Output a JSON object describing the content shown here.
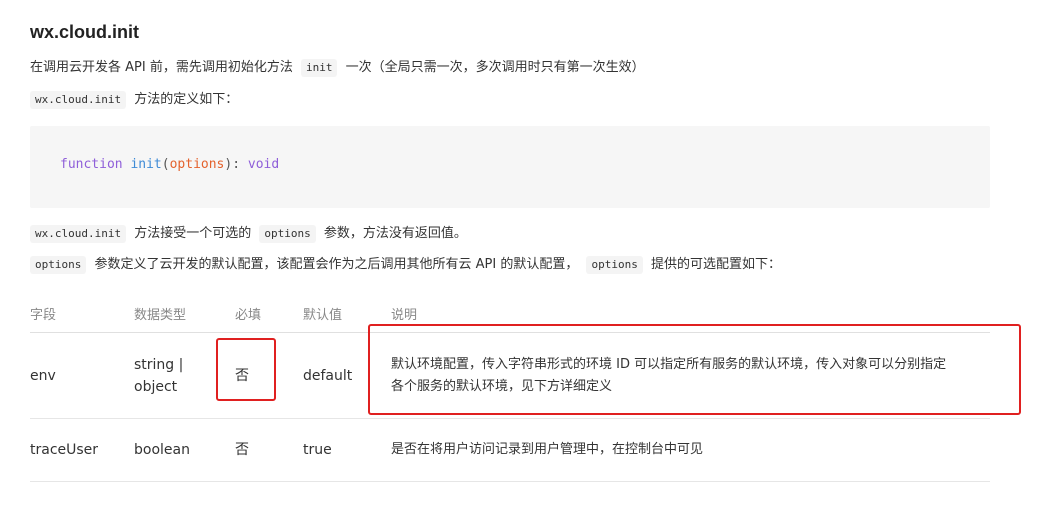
{
  "title": "wx.cloud.init",
  "intro": {
    "text_before": "在调用云开发各 API 前，需先调用初始化方法",
    "code": "init",
    "text_after": "一次（全局只需一次，多次调用时只有第一次生效）"
  },
  "definition_line": {
    "code": "wx.cloud.init",
    "text": "方法的定义如下："
  },
  "codeblock": {
    "keyword": "function",
    "fn_name": "init",
    "open_paren": "(",
    "param": "options",
    "close": "):",
    "return_type": "void"
  },
  "accepts_line": {
    "code1": "wx.cloud.init",
    "text1": "方法接受一个可选的",
    "code2": "options",
    "text2": "参数，方法没有返回值。"
  },
  "options_line": {
    "code1": "options",
    "text1": "参数定义了云开发的默认配置，该配置会作为之后调用其他所有云 API 的默认配置，",
    "code2": "options",
    "text2": "提供的可选配置如下："
  },
  "table": {
    "headers": [
      "字段",
      "数据类型",
      "必填",
      "默认值",
      "说明"
    ],
    "rows": [
      {
        "field": "env",
        "type_line1": "string |",
        "type_line2": "object",
        "required": "否",
        "default": "default",
        "desc_line1": "默认环境配置，传入字符串形式的环境 ID 可以指定所有服务的默认环境，传入对象可以分别指定",
        "desc_line2": "各个服务的默认环境，见下方详细定义"
      },
      {
        "field": "traceUser",
        "type_line1": "boolean",
        "required": "否",
        "default": "true",
        "desc_line1": "是否在将用户访问记录到用户管理中，在控制台中可见"
      }
    ]
  },
  "highlight_color": "#e02020"
}
